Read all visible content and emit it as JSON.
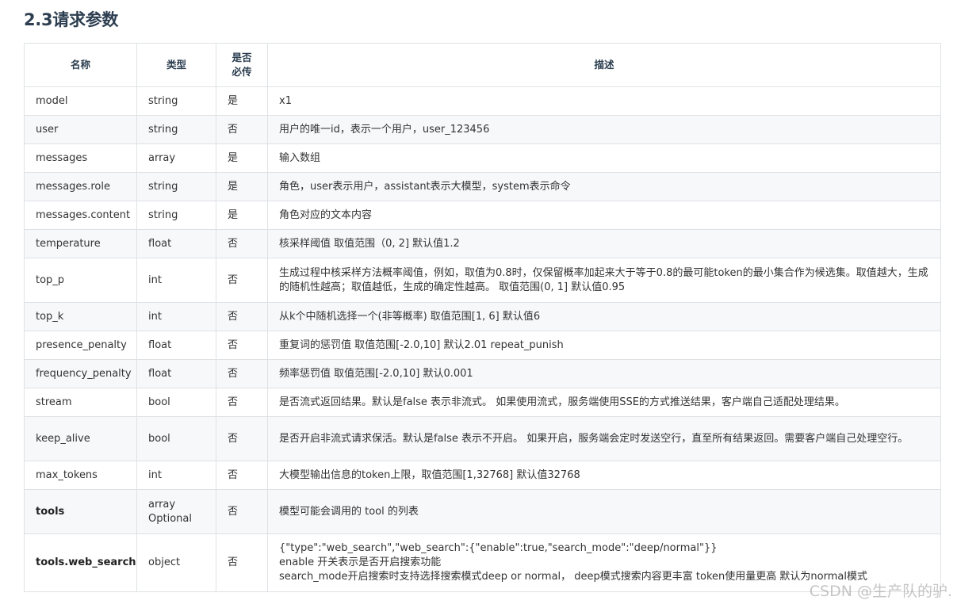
{
  "title": "2.3请求参数",
  "table": {
    "headers": {
      "name": "名称",
      "type": "类型",
      "required_line1": "是否",
      "required_line2": "必传",
      "desc": "描述"
    },
    "rows": [
      {
        "name": "model",
        "type": "string",
        "required": "是",
        "desc": "x1"
      },
      {
        "name": "user",
        "type": "string",
        "required": "否",
        "desc": "用户的唯一id，表示一个用户，user_123456"
      },
      {
        "name": "messages",
        "type": "array",
        "required": "是",
        "desc": "输入数组"
      },
      {
        "name": "messages.role",
        "type": "string",
        "required": "是",
        "desc": "角色，user表示用户，assistant表示大模型，system表示命令"
      },
      {
        "name": "messages.content",
        "type": "string",
        "required": "是",
        "desc": "角色对应的文本内容"
      },
      {
        "name": "temperature",
        "type": "float",
        "required": "否",
        "desc": "核采样阈值 取值范围（0, 2] 默认值1.2"
      },
      {
        "name": "top_p",
        "type": "int",
        "required": "否",
        "desc": "生成过程中核采样方法概率阈值，例如，取值为0.8时，仅保留概率加起来大于等于0.8的最可能token的最小集合作为候选集。取值越大，生成的随机性越高；取值越低，生成的确定性越高。 取值范围(0, 1] 默认值0.95"
      },
      {
        "name": "top_k",
        "type": "int",
        "required": "否",
        "desc": "从k个中随机选择一个(非等概率) 取值范围[1, 6] 默认值6"
      },
      {
        "name": "presence_penalty",
        "type": "float",
        "required": "否",
        "desc": "重复词的惩罚值 取值范围[-2.0,10] 默认2.01 repeat_punish"
      },
      {
        "name": "frequency_penalty",
        "type": "float",
        "required": "否",
        "desc": "频率惩罚值 取值范围[-2.0,10] 默认0.001"
      },
      {
        "name": "stream",
        "type": "bool",
        "required": "否",
        "desc": "是否流式返回结果。默认是false 表示非流式。 如果使用流式，服务端使用SSE的方式推送结果，客户端自己适配处理结果。"
      },
      {
        "name": "keep_alive",
        "type": "bool",
        "required": "否",
        "desc": "是否开启非流式请求保活。默认是false 表示不开启。 如果开启，服务端会定时发送空行，直至所有结果返回。需要客户端自己处理空行。"
      },
      {
        "name": "max_tokens",
        "type": "int",
        "required": "否",
        "desc": "大模型输出信息的token上限，取值范围[1,32768] 默认值32768"
      },
      {
        "name": "tools",
        "type_line1": "array",
        "type_line2": "Optional",
        "required": "否",
        "desc": "模型可能会调用的 tool 的列表"
      },
      {
        "name": "tools.web_search",
        "type": "object",
        "required": "否",
        "desc_line1": "{\"type\":\"web_search\",\"web_search\":{\"enable\":true,\"search_mode\":\"deep/normal\"}}",
        "desc_line2": "enable 开关表示是否开启搜索功能",
        "desc_line3": "search_mode开启搜索时支持选择搜索模式deep or normal， deep模式搜索内容更丰富 token使用量更高 默认为normal模式"
      }
    ]
  },
  "watermark": "CSDN @生产队的驴."
}
